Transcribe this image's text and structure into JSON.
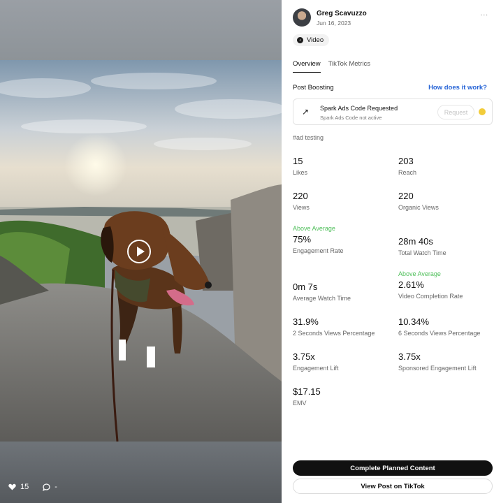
{
  "media": {
    "likes": "15",
    "comments": "-"
  },
  "post": {
    "author": "Greg Scavuzzo",
    "date": "Jun 16, 2023",
    "more": "...",
    "type_chip": "Video"
  },
  "tabs": [
    {
      "label": "Overview",
      "active": true
    },
    {
      "label": "TikTok Metrics",
      "active": false
    }
  ],
  "boosting": {
    "label": "Post Boosting",
    "help_link": "How does it work?",
    "card_title": "Spark Ads Code Requested",
    "card_subtitle": "Spark Ads Code not active",
    "request_button": "Request",
    "status_color": "#f2cc3a"
  },
  "hashtag": "#ad testing",
  "metrics": [
    {
      "value": "15",
      "label": "Likes",
      "badge": ""
    },
    {
      "value": "203",
      "label": "Reach",
      "badge": ""
    },
    {
      "value": "220",
      "label": "Views",
      "badge": ""
    },
    {
      "value": "220",
      "label": "Organic Views",
      "badge": ""
    },
    {
      "value": "75%",
      "label": "Engagement Rate",
      "badge": "Above Average"
    },
    {
      "value": "28m 40s",
      "label": "Total Watch Time",
      "badge": ""
    },
    {
      "value": "0m 7s",
      "label": "Average Watch Time",
      "badge": ""
    },
    {
      "value": "2.61%",
      "label": "Video Completion Rate",
      "badge": "Above Average"
    },
    {
      "value": "31.9%",
      "label": "2 Seconds Views Percentage",
      "badge": ""
    },
    {
      "value": "10.34%",
      "label": "6 Seconds Views Percentage",
      "badge": ""
    },
    {
      "value": "3.75x",
      "label": "Engagement Lift",
      "badge": ""
    },
    {
      "value": "3.75x",
      "label": "Sponsored Engagement Lift",
      "badge": ""
    },
    {
      "value": "$17.15",
      "label": "EMV",
      "badge": ""
    }
  ],
  "actions": {
    "primary": "Complete Planned Content",
    "secondary": "View Post on TikTok"
  },
  "colors": {
    "accent_link": "#2563d6",
    "above_average": "#4fbf5a",
    "primary_button": "#111111"
  }
}
